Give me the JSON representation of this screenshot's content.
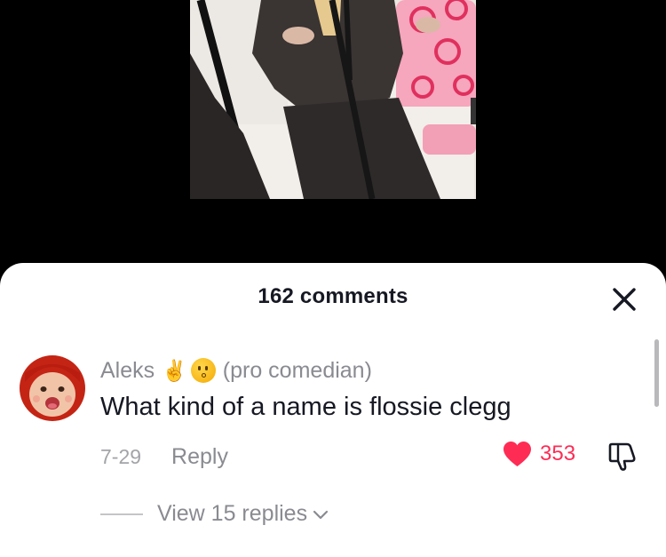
{
  "video": {
    "description_icon": "video-thumbnail"
  },
  "sheet": {
    "title": "162 comments",
    "close_icon": "close-icon"
  },
  "comment": {
    "author": "Aleks",
    "author_emojis": [
      "victory-hand-emoji",
      "kissing-face-emoji"
    ],
    "author_tag": "(pro comedian)",
    "text": "What kind of a name is flossie clegg",
    "date": "7-29",
    "reply_label": "Reply",
    "likes": "353",
    "liked": true,
    "accent_color": "#fe2c55"
  },
  "replies": {
    "label": "View 15 replies"
  }
}
